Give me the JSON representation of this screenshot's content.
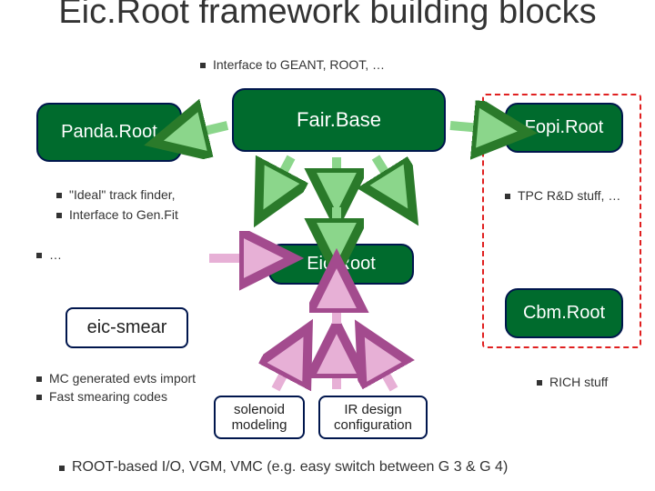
{
  "title": "Eic.Root framework building blocks",
  "top_bullet": "Interface to GEANT, ROOT, …",
  "nodes": {
    "fairbase": "Fair.Base",
    "pandaroot": "Panda.Root",
    "fopiroot": "Fopi.Root",
    "eicroot": "Eic.Root",
    "cbmroot": "Cbm.Root",
    "eicsmear": "eic-smear",
    "solenoid": "solenoid modeling",
    "irdesign": "IR design configuration"
  },
  "panda_bullets": {
    "a": "\"Ideal\" track finder,",
    "b": "Interface to Gen.Fit",
    "c": "…"
  },
  "fopi_bullet": "TPC R&D stuff, …",
  "cbm_bullet": "RICH stuff",
  "smear_bullets": {
    "a": "MC generated evts  import",
    "b": "Fast smearing codes"
  },
  "footer_bullet": "ROOT-based I/O, VGM, VMC (e.g. easy switch between G 3 & G 4)"
}
